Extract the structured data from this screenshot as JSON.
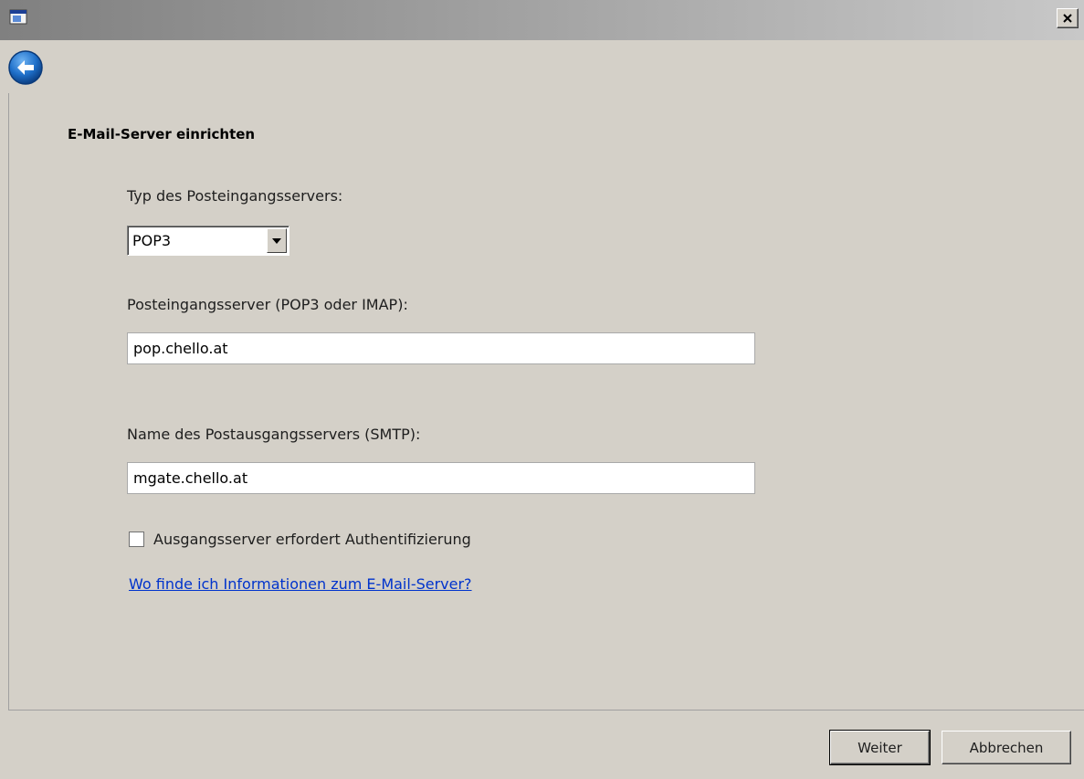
{
  "window": {
    "close_symbol": "×"
  },
  "form": {
    "heading": "E-Mail-Server einrichten",
    "incoming_type_label": "Typ des Posteingangsservers:",
    "incoming_type_value": "POP3",
    "incoming_server_label": "Posteingangsserver (POP3 oder IMAP):",
    "incoming_server_value": "pop.chello.at",
    "outgoing_server_label": "Name des Postausgangsservers (SMTP):",
    "outgoing_server_value": "mgate.chello.at",
    "auth_checkbox_label": "Ausgangsserver erfordert Authentifizierung",
    "auth_checked": false,
    "help_link": "Wo finde ich Informationen zum E-Mail-Server?"
  },
  "footer": {
    "next_label": "Weiter",
    "cancel_label": "Abbrechen"
  },
  "icons": {
    "back": "back-arrow-icon",
    "app": "window-app-icon",
    "close": "close-icon",
    "dropdown": "chevron-down-icon"
  },
  "colors": {
    "link": "#0033cc",
    "back_button": "#1e6fc9"
  }
}
